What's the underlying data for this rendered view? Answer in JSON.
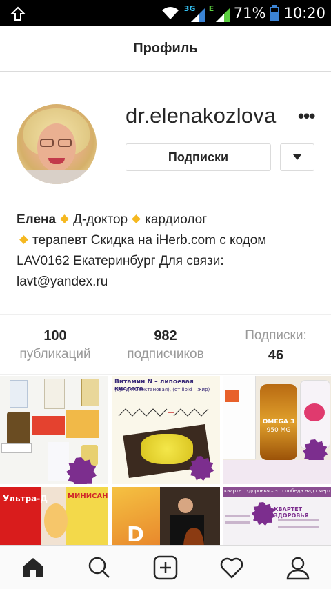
{
  "status_bar": {
    "net_3g": "3G",
    "net_e": "E",
    "battery": "71%",
    "time": "10:20"
  },
  "header": {
    "title": "Профиль"
  },
  "profile": {
    "username": "dr.elenakozlova",
    "follow_button_label": "Подписки",
    "bio": {
      "name": "Елена",
      "part1": "Д-доктор",
      "part2": "кардиолог",
      "part3": "терапевт Скидка на iHerb.com с кодом",
      "line3": "LAV0162 Екатеринбург Для связи:",
      "line4": "lavt@yandex.ru"
    }
  },
  "stats": {
    "posts": {
      "value": "100",
      "label": "публикаций"
    },
    "followers": {
      "value": "982",
      "label": "подписчиков"
    },
    "following": {
      "value": "46",
      "label": "Подписки:"
    }
  },
  "grid": {
    "post2_title": "Витамин N – липоевая кислота",
    "post2_sub": "(6,8-дитиооктановая), (от lipid – жир)",
    "post3_label": "OMEGA 3",
    "post3_sub": "950 MG",
    "post4_label": "Ультра-Д",
    "post4_label2": "МИНИСАН",
    "post6_title": "квартет здоровья – это победа над смертельным квартетом",
    "post6_label": "КВАРТЕТ ЗДОРОВЬЯ"
  },
  "nav": {
    "items": [
      "home-icon",
      "search-icon",
      "add-icon",
      "heart-icon",
      "profile-icon"
    ]
  },
  "colors": {
    "accent": "#f5b820",
    "badge": "#7c2e8e",
    "muted": "#999999"
  }
}
